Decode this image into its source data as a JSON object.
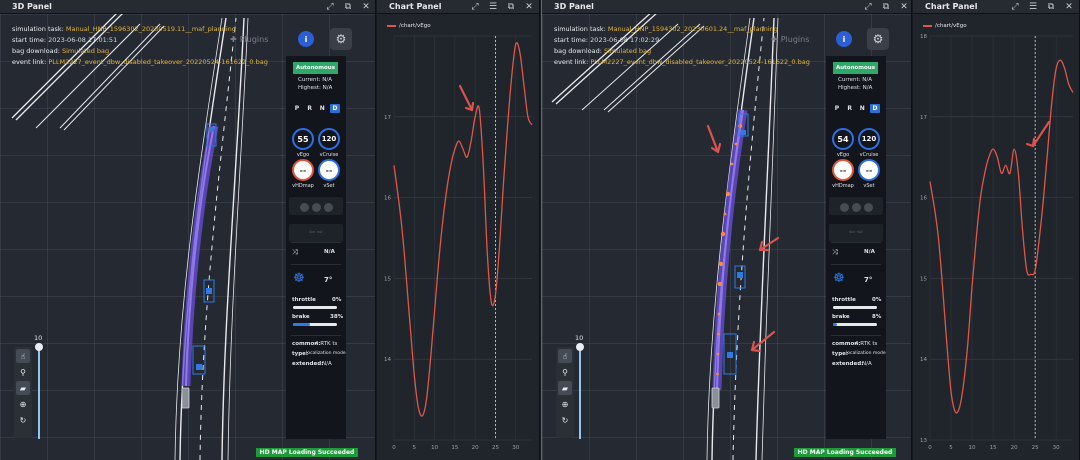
{
  "panels": {
    "p3d_left": {
      "title": "3D Panel"
    },
    "chart_left": {
      "title": "Chart Panel"
    },
    "p3d_right": {
      "title": "3D Panel"
    },
    "chart_right": {
      "title": "Chart Panel"
    }
  },
  "sim_left": {
    "task_label": "simulation task:",
    "task_value": "Manual_HNP_1596302_20230519.11__maf_planning",
    "start_label": "start time:",
    "start_value": "2023-06-08 17:01:51",
    "bag_label": "bag download:",
    "bag_value": "Simulated bag",
    "event_label": "event link:",
    "event_value": "PLLM2227_event_dbw_disabled_takeover_20220524-161622_0.bag"
  },
  "sim_right": {
    "task_label": "simulation task:",
    "task_value": "Manual_HNP_1594302_20230601.24__maf_planning",
    "start_label": "start time:",
    "start_value": "2023-06-08 17:02:29",
    "bag_label": "bag download:",
    "bag_value": "Simulated bag",
    "event_label": "event link:",
    "event_value": "PLLM2227_event_dbw_disabled_takeover_20220524-161622_0.bag"
  },
  "toolbar": {
    "plugins_label": "Plugins",
    "info_label": "i"
  },
  "dash_left": {
    "mode": "Autonomous",
    "current": "Current: N/A",
    "highest": "Highest: N/A",
    "gears": [
      "P",
      "R",
      "N",
      "D"
    ],
    "active_gear": "D",
    "vego": "55",
    "vego_label": "vEgo",
    "vcruise": "120",
    "vcruise_label": "vCruise",
    "vhdmap": "--",
    "vhdmap_label": "vHDmap",
    "vset": "--",
    "vset_label": "vSet",
    "lane_value": "N/A",
    "steer_angle": "7°",
    "throttle_label": "throttle",
    "throttle_value": "0%",
    "throttle_pct": 0,
    "brake_label": "brake",
    "brake_value": "38%",
    "brake_pct": 38,
    "common_label": "common:",
    "common_value": "4.RTK ts",
    "type_label": "type:",
    "type_value": "localization mode",
    "extended_label": "extended:",
    "extended_value": "N/A"
  },
  "dash_right": {
    "mode": "Autonomous",
    "current": "Current: N/A",
    "highest": "Highest: N/A",
    "gears": [
      "P",
      "R",
      "N",
      "D"
    ],
    "active_gear": "D",
    "vego": "54",
    "vego_label": "vEgo",
    "vcruise": "120",
    "vcruise_label": "vCruise",
    "vhdmap": "--",
    "vhdmap_label": "vHDmap",
    "vset": "--",
    "vset_label": "vSet",
    "lane_value": "N/A",
    "steer_angle": "7°",
    "throttle_label": "throttle",
    "throttle_value": "0%",
    "throttle_pct": 0,
    "brake_label": "brake",
    "brake_value": "8%",
    "brake_pct": 8,
    "common_label": "common:",
    "common_value": "4.RTK ts",
    "type_label": "type:",
    "type_value": "localization mode",
    "extended_label": "extended:",
    "extended_value": "N/A"
  },
  "zoom": {
    "value": "10"
  },
  "status": {
    "message": "HD MAP Loading Succeeded"
  },
  "icons": [
    "expand-icon",
    "screenshot-icon",
    "close-icon",
    "database-icon",
    "puzzle-icon",
    "gear-icon",
    "hand-icon",
    "pin-icon",
    "ruler-icon",
    "globe-icon",
    "rotate-icon",
    "steering-wheel-icon",
    "lane-change-icon"
  ],
  "colors": {
    "series": "#e0574a",
    "accent": "#2f6fe0",
    "autonomous": "#2fa86a",
    "status_ok": "#1f9a3a",
    "highlight_text": "#e0b53c",
    "trajectory": "#6b4fd8"
  },
  "chart_data": [
    {
      "type": "line",
      "legend": [
        "/chart/vEgo"
      ],
      "xlim": [
        0,
        34
      ],
      "ylim": [
        13,
        18
      ],
      "xticks": [
        0,
        5,
        10,
        15,
        20,
        25,
        30
      ],
      "yticks": [
        13,
        14,
        15,
        16,
        17,
        18
      ],
      "ytick_labels": [
        "",
        "14",
        "15",
        "16",
        "17",
        ""
      ],
      "cursor_x": 25,
      "series": [
        {
          "x": [
            0,
            2,
            4,
            5,
            6,
            7,
            8,
            9,
            10,
            11,
            12,
            13,
            14,
            15,
            16,
            17,
            18,
            19,
            20,
            21,
            22,
            23,
            24,
            25,
            26,
            27,
            28,
            29,
            30,
            31,
            32,
            33,
            34
          ],
          "values": [
            16.4,
            15.6,
            14.4,
            13.8,
            13.4,
            13.3,
            13.5,
            14.0,
            14.6,
            15.2,
            15.7,
            16.1,
            16.4,
            16.6,
            16.7,
            16.6,
            16.5,
            16.7,
            17.0,
            17.1,
            16.4,
            15.3,
            14.7,
            14.8,
            15.4,
            16.2,
            16.9,
            17.5,
            17.9,
            17.8,
            17.4,
            17.0,
            16.9
          ]
        }
      ],
      "annotations": [
        "hand-drawn arrow pointing to peak near x=21"
      ]
    },
    {
      "type": "line",
      "legend": [
        "/chart/vEgo"
      ],
      "xlim": [
        0,
        34
      ],
      "ylim": [
        13,
        18
      ],
      "xticks": [
        0,
        5,
        10,
        15,
        20,
        25,
        30
      ],
      "yticks": [
        13,
        14,
        15,
        16,
        17,
        18
      ],
      "ytick_labels": [
        "13",
        "14",
        "15",
        "16",
        "17",
        "18"
      ],
      "cursor_x": 25,
      "series": [
        {
          "x": [
            0,
            2,
            4,
            5,
            6,
            7,
            8,
            9,
            10,
            11,
            12,
            13,
            14,
            15,
            16,
            17,
            18,
            19,
            20,
            21,
            22,
            23,
            24,
            25,
            26,
            27,
            28,
            29,
            30,
            31,
            32,
            33,
            34
          ],
          "values": [
            16.2,
            15.5,
            14.2,
            13.6,
            13.35,
            13.4,
            13.7,
            14.2,
            14.9,
            15.5,
            16.0,
            16.3,
            16.5,
            16.6,
            16.5,
            16.3,
            16.4,
            16.3,
            16.6,
            16.3,
            15.6,
            15.1,
            15.05,
            15.1,
            15.5,
            16.0,
            16.6,
            17.2,
            17.6,
            17.7,
            17.6,
            17.4,
            17.3
          ]
        }
      ],
      "annotations": [
        "hand-drawn arrow pointing to dip near x=24"
      ]
    }
  ]
}
